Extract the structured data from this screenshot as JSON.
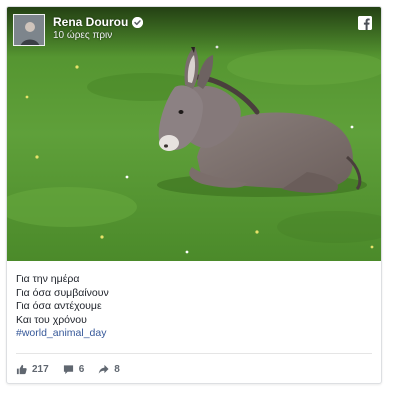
{
  "post": {
    "author": "Rena Dourou",
    "timestamp": "10 ώρες πριν",
    "lines": [
      "Για την ημέρα",
      "Για όσα συμβαίνουν",
      "Για όσα αντέχουμε",
      "Και του χρόνου"
    ],
    "hashtag": "#world_animal_day",
    "stats": {
      "likes": "217",
      "comments": "6",
      "shares": "8"
    }
  },
  "colors": {
    "link": "#365899",
    "text": "#1d2129",
    "muted": "#606770",
    "border": "#dddfe2",
    "grass": "#5d9a34"
  },
  "icons": {
    "platform": "facebook-icon",
    "verified": "verified-badge-icon",
    "like": "thumbs-up-icon",
    "comment": "comment-bubble-icon",
    "share": "share-arrow-icon"
  }
}
